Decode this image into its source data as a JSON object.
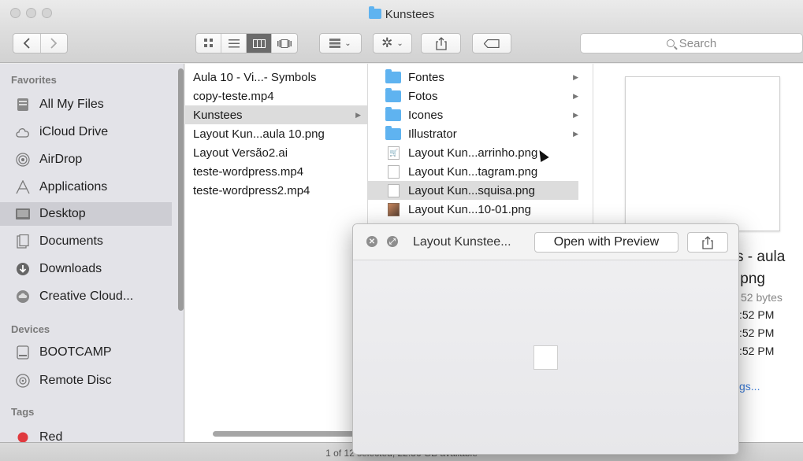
{
  "window": {
    "title": "Kunstees"
  },
  "toolbar": {
    "back_icon": "chevron-left-icon",
    "forward_icon": "chevron-right-icon",
    "view_modes": [
      "icon-view",
      "list-view",
      "column-view",
      "cover-flow-view"
    ],
    "active_view": "column-view",
    "search_placeholder": "Search"
  },
  "sidebar": {
    "favorites_header": "Favorites",
    "favorites": [
      {
        "label": "All My Files",
        "icon": "all-files-icon"
      },
      {
        "label": "iCloud Drive",
        "icon": "cloud-icon"
      },
      {
        "label": "AirDrop",
        "icon": "airdrop-icon"
      },
      {
        "label": "Applications",
        "icon": "applications-icon"
      },
      {
        "label": "Desktop",
        "icon": "desktop-icon",
        "selected": true
      },
      {
        "label": "Documents",
        "icon": "documents-icon"
      },
      {
        "label": "Downloads",
        "icon": "downloads-icon"
      },
      {
        "label": "Creative Cloud...",
        "icon": "creative-cloud-icon"
      }
    ],
    "devices_header": "Devices",
    "devices": [
      {
        "label": "BOOTCAMP",
        "icon": "drive-icon"
      },
      {
        "label": "Remote Disc",
        "icon": "disc-icon"
      }
    ],
    "tags_header": "Tags",
    "tags": [
      {
        "label": "Red",
        "color": "#e0393e"
      }
    ]
  },
  "column1": {
    "items": [
      {
        "label": "Aula 10 - Vi...- Symbols"
      },
      {
        "label": "copy-teste.mp4"
      },
      {
        "label": "Kunstees",
        "selected": true,
        "folder": true
      },
      {
        "label": "Layout Kun...aula 10.png"
      },
      {
        "label": "Layout Versão2.ai"
      },
      {
        "label": "teste-wordpress.mp4"
      },
      {
        "label": "teste-wordpress2.mp4"
      }
    ]
  },
  "column2": {
    "items": [
      {
        "label": "Fontes",
        "type": "folder"
      },
      {
        "label": "Fotos",
        "type": "folder"
      },
      {
        "label": "Icones",
        "type": "folder"
      },
      {
        "label": "Illustrator",
        "type": "folder"
      },
      {
        "label": "Layout Kun...arrinho.png",
        "type": "cart"
      },
      {
        "label": "Layout Kun...tagram.png",
        "type": "doc"
      },
      {
        "label": "Layout Kun...squisa.png",
        "type": "doc",
        "selected": true
      },
      {
        "label": "Layout Kun...10-01.png",
        "type": "img"
      }
    ]
  },
  "preview": {
    "name_line1": "s - aula",
    "name_line2": ".png",
    "size": "52 bytes",
    "date1": ":52 PM",
    "date2": ":52 PM",
    "date3": ":52 PM",
    "more_link": "gs..."
  },
  "quicklook": {
    "title": "Layout Kunstee...",
    "open_button": "Open with Preview",
    "close_icon": "close-icon",
    "fullscreen_icon": "fullscreen-icon",
    "share_icon": "share-icon"
  },
  "statusbar": {
    "text": "1 of 12 selected, 22.36 GB available"
  }
}
